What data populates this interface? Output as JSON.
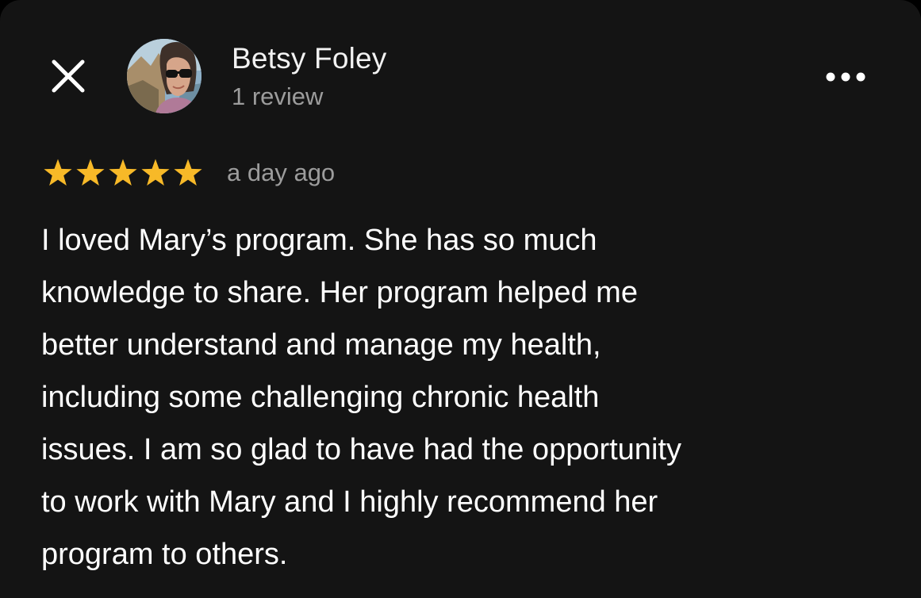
{
  "reviewer": {
    "name": "Betsy Foley",
    "review_count": "1 review"
  },
  "rating": {
    "stars": 5,
    "max": 5,
    "color": "#f7b928"
  },
  "time_ago": "a day ago",
  "review_lines": [
    "I loved Mary’s program. She has so much",
    "knowledge to share. Her program helped me",
    "better understand and manage my health,",
    "including some challenging chronic health",
    "issues. I am so glad to have had the opportunity",
    "to work with Mary and I highly recommend her",
    "program to others."
  ],
  "icons": {
    "close": "close-icon",
    "more": "more-horizontal-icon",
    "star": "star-icon"
  },
  "colors": {
    "background": "#141414",
    "primary_text": "#ffffff",
    "secondary_text": "#9c9c9c"
  }
}
